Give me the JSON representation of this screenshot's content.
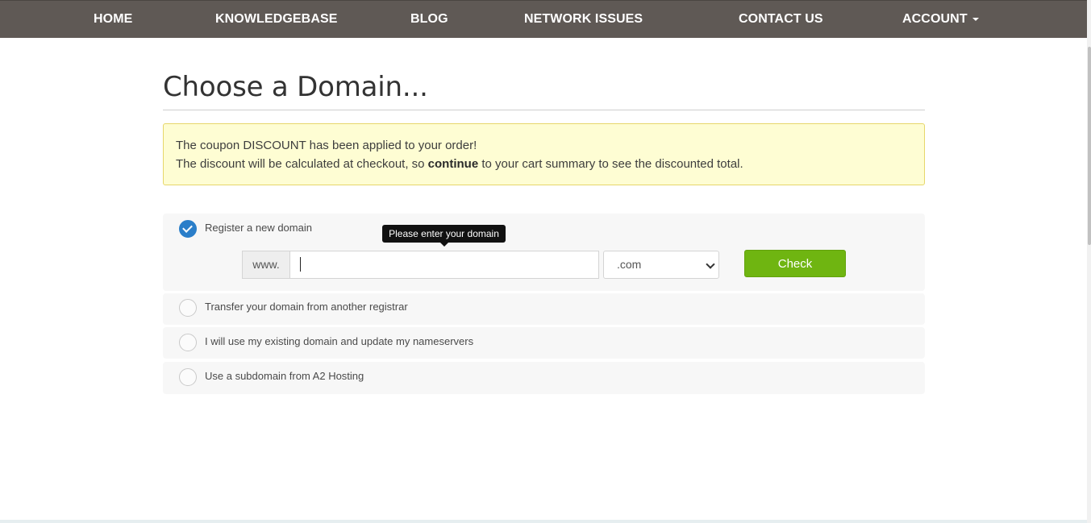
{
  "nav": {
    "home": "HOME",
    "knowledgebase": "KNOWLEDGEBASE",
    "blog": "BLOG",
    "network_issues": "NETWORK ISSUES",
    "contact_us": "CONTACT US",
    "account": "ACCOUNT"
  },
  "page": {
    "title": "Choose a Domain..."
  },
  "alert": {
    "line1": "The coupon DISCOUNT has been applied to your order!",
    "line2_before": "The discount will be calculated at checkout, so ",
    "line2_bold": "continue",
    "line2_after": " to your cart summary to see the discounted total."
  },
  "options": {
    "register": {
      "label": "Register a new domain",
      "checked": true,
      "tooltip": "Please enter your domain",
      "prefix": "www.",
      "input_value": "",
      "tld_selected": ".com",
      "check_label": "Check"
    },
    "transfer": {
      "label": "Transfer your domain from another registrar",
      "checked": false
    },
    "existing": {
      "label": "I will use my existing domain and update my nameservers",
      "checked": false
    },
    "subdomain": {
      "label": "Use a subdomain from A2 Hosting",
      "checked": false
    }
  },
  "colors": {
    "nav_bg": "#5f5955",
    "radio_checked": "#2a7ec9",
    "check_button": "#6fb511",
    "alert_bg": "#fefdd3",
    "alert_border": "#e6d66a"
  },
  "icons": {
    "account_caret": "caret-down-icon",
    "radio_checked": "checkmark-icon",
    "select_chevron": "chevron-down-icon"
  }
}
